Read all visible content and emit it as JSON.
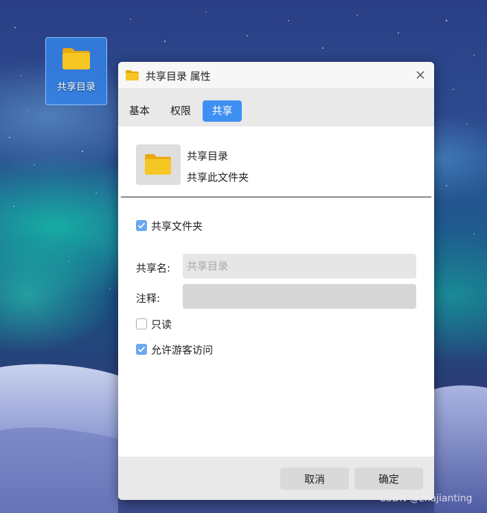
{
  "desktop": {
    "icon_label": "共享目录",
    "icon": "folder-icon"
  },
  "dialog": {
    "title": "共享目录 属性",
    "title_icon": "folder-icon",
    "close_icon": "close-icon",
    "tabs": [
      {
        "label": "基本",
        "active": false
      },
      {
        "label": "权限",
        "active": false
      },
      {
        "label": "共享",
        "active": true
      }
    ],
    "header": {
      "name": "共享目录",
      "description": "共享此文件夹"
    },
    "share_folder": {
      "label": "共享文件夹",
      "checked": true
    },
    "share_name": {
      "label": "共享名:",
      "placeholder": "共享目录",
      "value": ""
    },
    "comment": {
      "label": "注释:",
      "value": ""
    },
    "read_only": {
      "label": "只读",
      "checked": false
    },
    "allow_guest": {
      "label": "允许游客访问",
      "checked": true
    },
    "buttons": {
      "cancel": "取消",
      "ok": "确定"
    }
  },
  "watermark": "CSDN @zhajianting",
  "colors": {
    "accent": "#3d8ff2",
    "checkbox": "#6aa8f0",
    "folder_yellow": "#f6c623",
    "desk_selection": "#3482e8"
  }
}
